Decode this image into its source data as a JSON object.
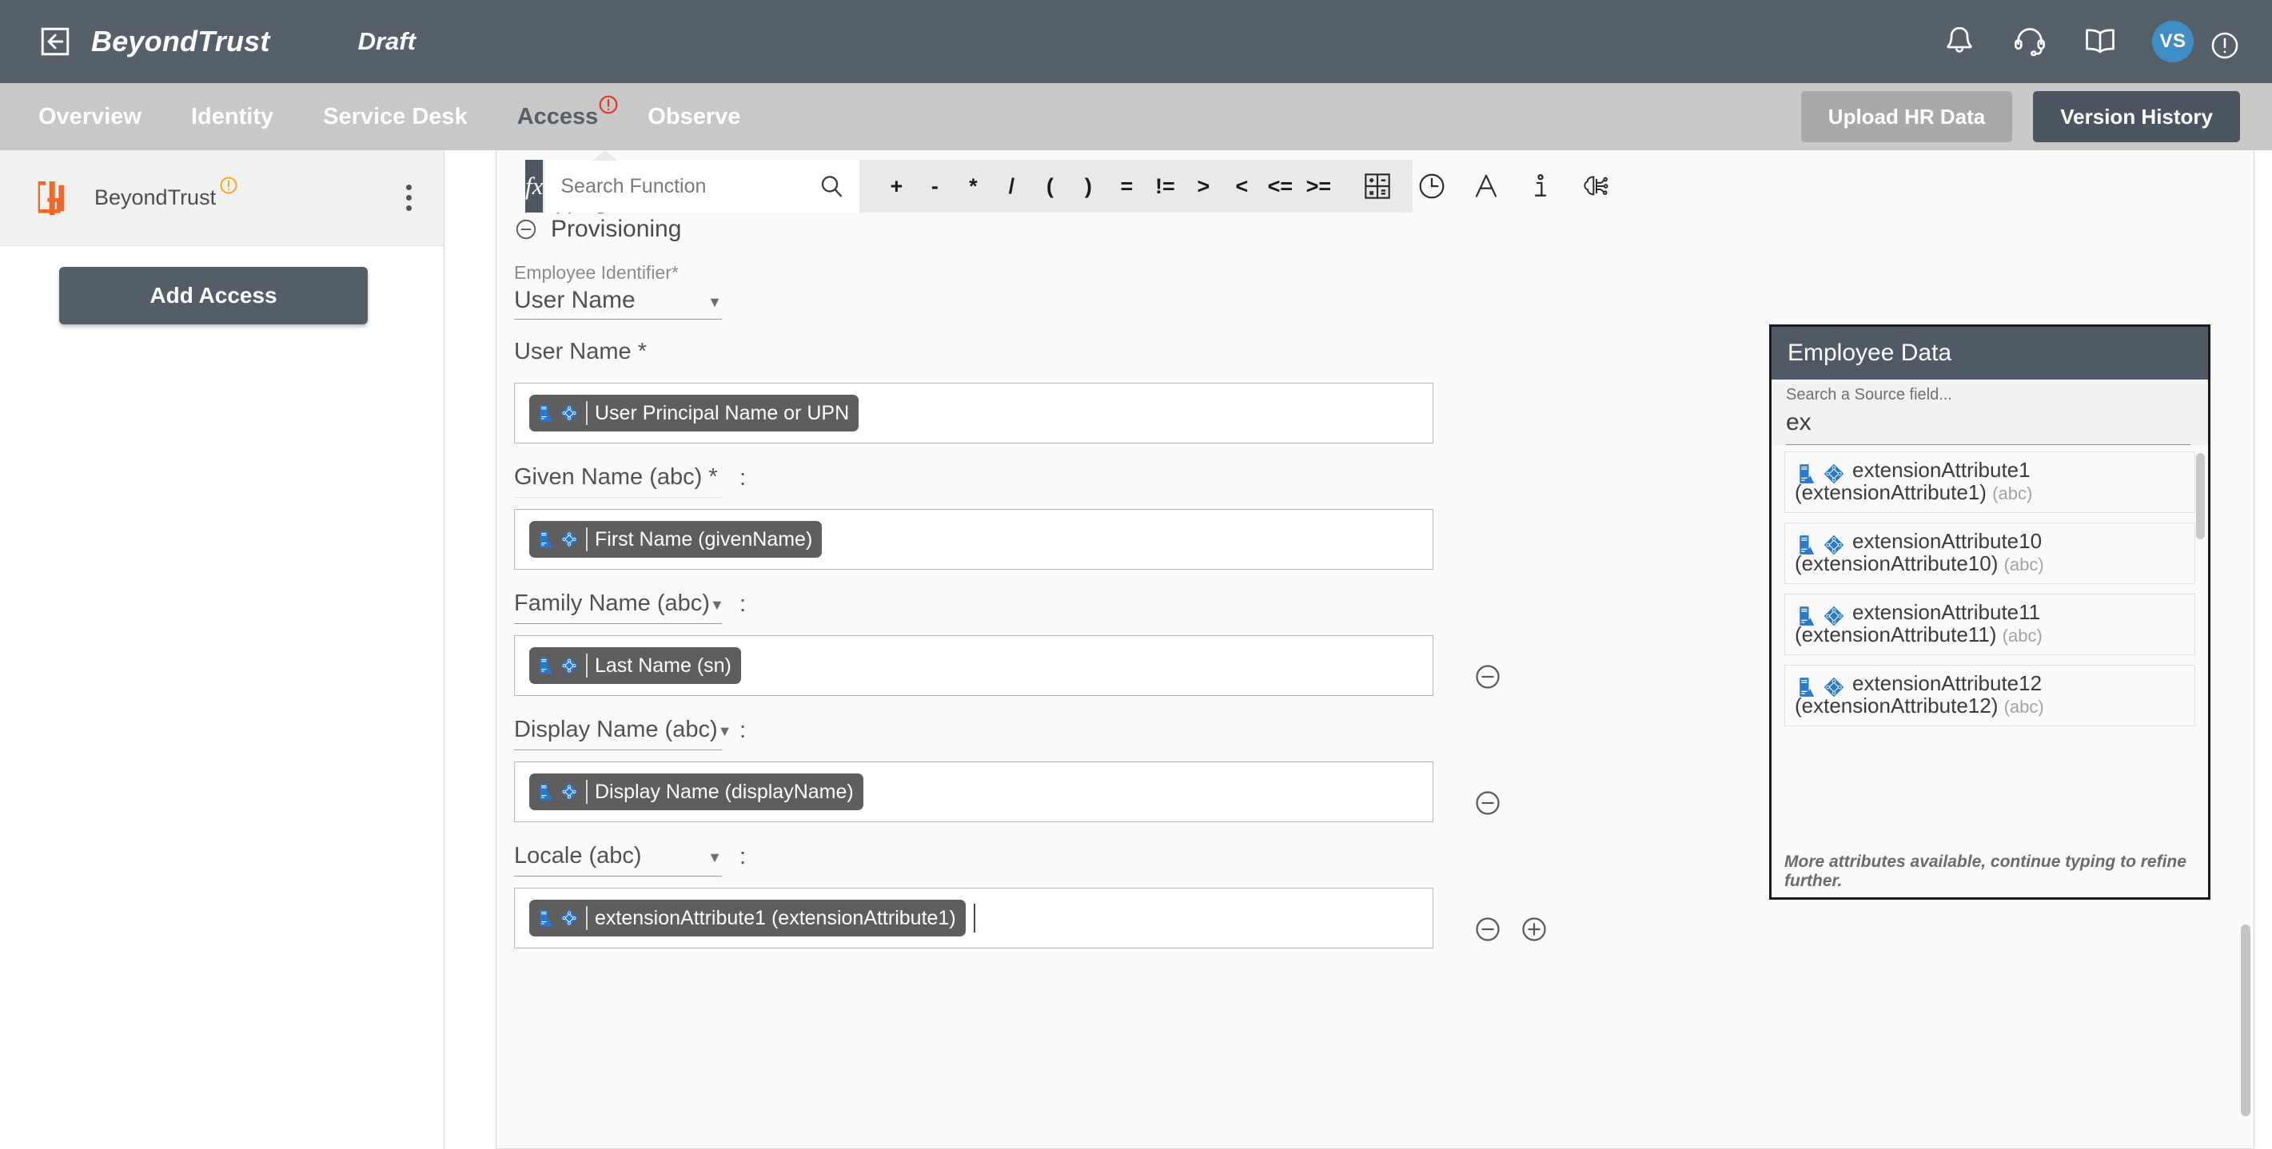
{
  "topbar": {
    "back_icon": "back-arrow-icon",
    "brand": "BeyondTrust",
    "draft_label": "Draft",
    "icons": [
      "bell-icon",
      "headset-icon",
      "book-icon"
    ],
    "avatar_initials": "VS",
    "alert_icon": "exclamation-circle-icon"
  },
  "nav": {
    "items": [
      {
        "label": "Overview",
        "active": false,
        "badge": false
      },
      {
        "label": "Identity",
        "active": false,
        "badge": false
      },
      {
        "label": "Service Desk",
        "active": false,
        "badge": false
      },
      {
        "label": "Access",
        "active": true,
        "badge": true
      },
      {
        "label": "Observe",
        "active": false,
        "badge": false
      }
    ],
    "upload_button": "Upload HR Data",
    "version_button": "Version History"
  },
  "sidebar": {
    "connector_name": "BeyondTrust",
    "connector_badge": "warning-circle-icon",
    "kebab": "more-options-icon",
    "add_access_button": "Add Access"
  },
  "formula_bar": {
    "fx_label": "fx",
    "search_placeholder": "Search Function",
    "search_value": "",
    "operators": [
      "+",
      "-",
      "*",
      "/",
      "(",
      ")",
      "=",
      "!=",
      ">",
      "<",
      "<=",
      ">="
    ],
    "tool_icons": [
      "calculator-icon",
      "clock-icon",
      "text-format-icon",
      "info-icon",
      "ai-brain-icon"
    ]
  },
  "section": {
    "collapse_icon": "minus-circle-icon",
    "title": "Provisioning",
    "ghost_label": "Mapping"
  },
  "form": {
    "employee_identifier": {
      "caption": "Employee Identifier*",
      "value": "User Name"
    },
    "rows": [
      {
        "label": "User Name *",
        "has_caret": false,
        "has_colon": false,
        "underline": "solid",
        "token": "User Principal Name or UPN",
        "token_icons": [
          "server-source-icon",
          "active-directory-icon"
        ],
        "actions": [],
        "cursor": false
      },
      {
        "label": "Given Name (abc) *",
        "has_caret": false,
        "has_colon": true,
        "underline": "faint",
        "token": "First Name (givenName)",
        "token_icons": [
          "server-source-icon",
          "active-directory-icon"
        ],
        "actions": [],
        "cursor": false
      },
      {
        "label": "Family Name (abc)",
        "has_caret": true,
        "has_colon": true,
        "underline": "solid",
        "token": "Last Name (sn)",
        "token_icons": [
          "server-source-icon",
          "active-directory-icon"
        ],
        "actions": [
          "minus-circle-icon"
        ],
        "cursor": false
      },
      {
        "label": "Display Name (abc)",
        "has_caret": true,
        "has_colon": true,
        "underline": "solid",
        "token": "Display Name (displayName)",
        "token_icons": [
          "server-source-icon",
          "active-directory-icon"
        ],
        "actions": [
          "minus-circle-icon"
        ],
        "cursor": false
      },
      {
        "label": "Locale (abc)",
        "has_caret": true,
        "has_colon": true,
        "underline": "solid",
        "token": "extensionAttribute1 (extensionAttribute1)",
        "token_icons": [
          "server-source-icon",
          "active-directory-icon"
        ],
        "actions": [
          "minus-circle-icon",
          "plus-circle-icon"
        ],
        "cursor": true
      }
    ]
  },
  "employee_data_panel": {
    "title": "Employee Data",
    "search_caption": "Search a Source field...",
    "search_value": "ex",
    "items": [
      {
        "name": "extensionAttribute1 (extensionAttribute1)",
        "type": "(abc)",
        "icons": [
          "server-source-icon",
          "active-directory-icon"
        ]
      },
      {
        "name": "extensionAttribute10 (extensionAttribute10)",
        "type": "(abc)",
        "icons": [
          "server-source-icon",
          "active-directory-icon"
        ]
      },
      {
        "name": "extensionAttribute11 (extensionAttribute11)",
        "type": "(abc)",
        "icons": [
          "server-source-icon",
          "active-directory-icon"
        ]
      },
      {
        "name": "extensionAttribute12 (extensionAttribute12)",
        "type": "(abc)",
        "icons": [
          "server-source-icon",
          "active-directory-icon"
        ]
      }
    ],
    "footer": "More attributes available, continue typing to refine further."
  },
  "colors": {
    "topbar_bg": "#56606b",
    "navbar_bg": "#c8c8c8",
    "accent_blue": "#3f8fc6",
    "logo_orange": "#ef6a28",
    "token_bg": "#5e5e5e",
    "source_icon_blue": "#2878d0",
    "warning_orange": "#f5a623",
    "alert_red": "#e8352a"
  }
}
